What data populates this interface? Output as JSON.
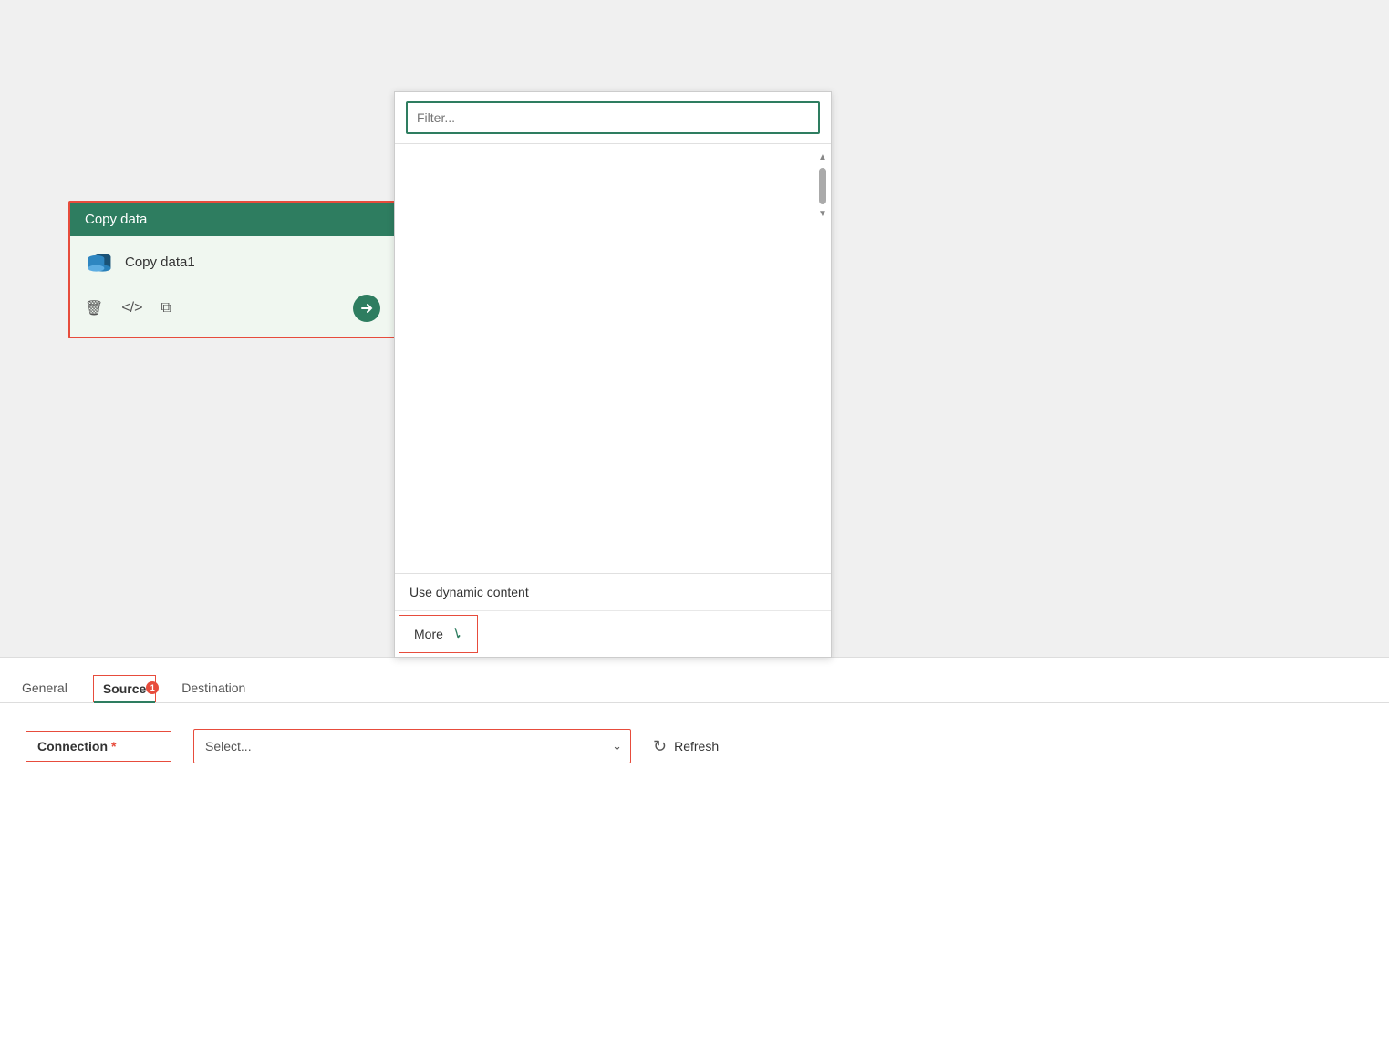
{
  "canvas": {
    "background": "#f0f0f0"
  },
  "copy_data_card": {
    "header": "Copy data",
    "item_name": "Copy data1",
    "actions": {
      "delete_label": "delete",
      "code_label": "code",
      "copy_label": "copy",
      "arrow_label": "navigate"
    }
  },
  "dropdown": {
    "filter_placeholder": "Filter...",
    "items": [],
    "footer": {
      "dynamic_content_label": "Use dynamic content",
      "more_label": "More"
    }
  },
  "tabs": [
    {
      "id": "general",
      "label": "General",
      "active": false,
      "badge": null
    },
    {
      "id": "source",
      "label": "Source",
      "active": true,
      "badge": "1"
    },
    {
      "id": "destination",
      "label": "Destination",
      "active": false,
      "badge": null
    }
  ],
  "panel": {
    "connection_label": "Connection",
    "required_star": "*",
    "select_placeholder": "Select...",
    "refresh_label": "Refresh"
  }
}
